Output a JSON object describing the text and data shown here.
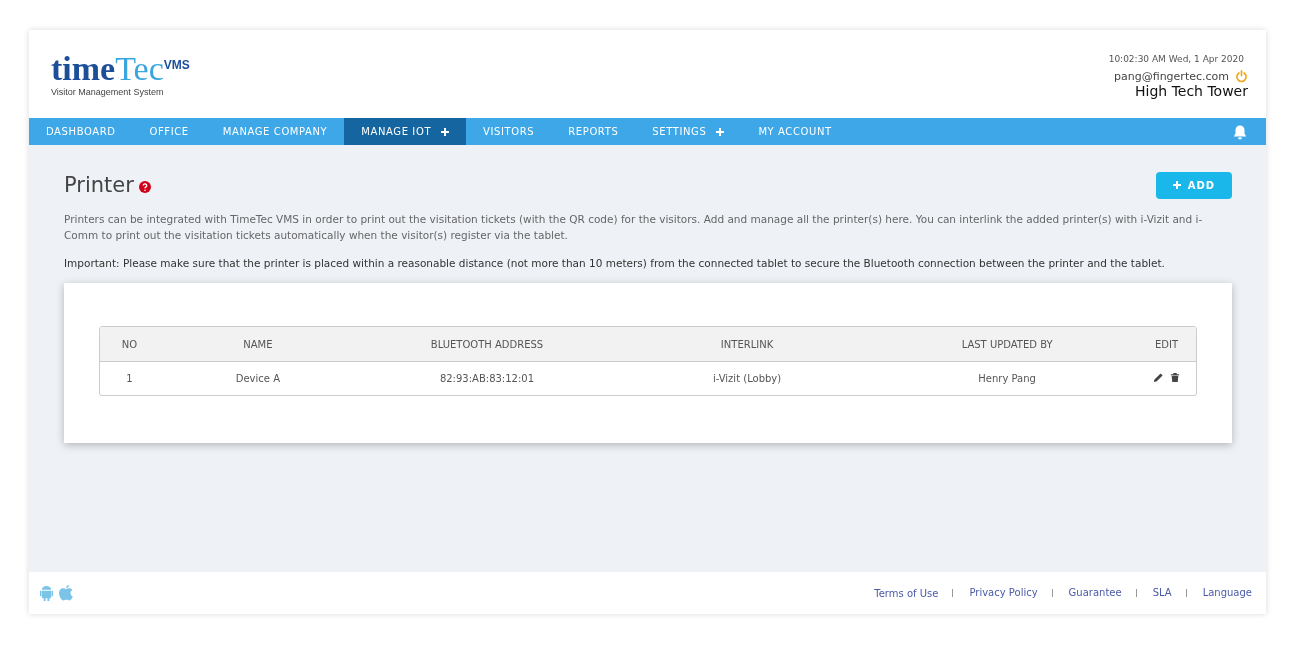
{
  "logo": {
    "word_dark": "time",
    "word_light": "Tec",
    "badge": "VMS",
    "tagline": "Visitor Management System"
  },
  "header": {
    "datetime": "10:02:30 AM  Wed, 1 Apr 2020",
    "email": "pang@fingertec.com",
    "site": "High Tech Tower"
  },
  "nav": [
    {
      "label": "DASHBOARD",
      "selected": false,
      "expandable": false
    },
    {
      "label": "OFFICE",
      "selected": false,
      "expandable": false
    },
    {
      "label": "MANAGE COMPANY",
      "selected": false,
      "expandable": false
    },
    {
      "label": "MANAGE IOT",
      "selected": true,
      "expandable": true
    },
    {
      "label": "VISITORS",
      "selected": false,
      "expandable": false
    },
    {
      "label": "REPORTS",
      "selected": false,
      "expandable": false
    },
    {
      "label": "SETTINGS",
      "selected": false,
      "expandable": true
    },
    {
      "label": "MY ACCOUNT",
      "selected": false,
      "expandable": false
    }
  ],
  "page": {
    "title": "Printer",
    "add_button": "ADD",
    "description": "Printers can be integrated with TimeTec VMS in order to print out the visitation tickets (with the QR code) for the visitors. Add and manage all the printer(s) here. You can interlink the added printer(s) with i-Vizit and i-Comm to print out the visitation tickets automatically when the visitor(s) register via the tablet.",
    "important": "Important: Please make sure that the printer is placed within a reasonable distance (not more than 10 meters) from the connected tablet to secure the Bluetooth connection between the printer and the tablet."
  },
  "table": {
    "columns": [
      "NO",
      "NAME",
      "BLUETOOTH ADDRESS",
      "INTERLINK",
      "LAST UPDATED BY",
      "EDIT"
    ],
    "rows": [
      {
        "no": "1",
        "name": "Device A",
        "bluetooth_address": "82:93:AB:83:12:01",
        "interlink": "i-Vizit (Lobby)",
        "last_updated_by": "Henry Pang"
      }
    ]
  },
  "footer": {
    "links": [
      "Terms of Use",
      "Privacy Policy",
      "Guarantee",
      "SLA",
      "Language"
    ]
  }
}
